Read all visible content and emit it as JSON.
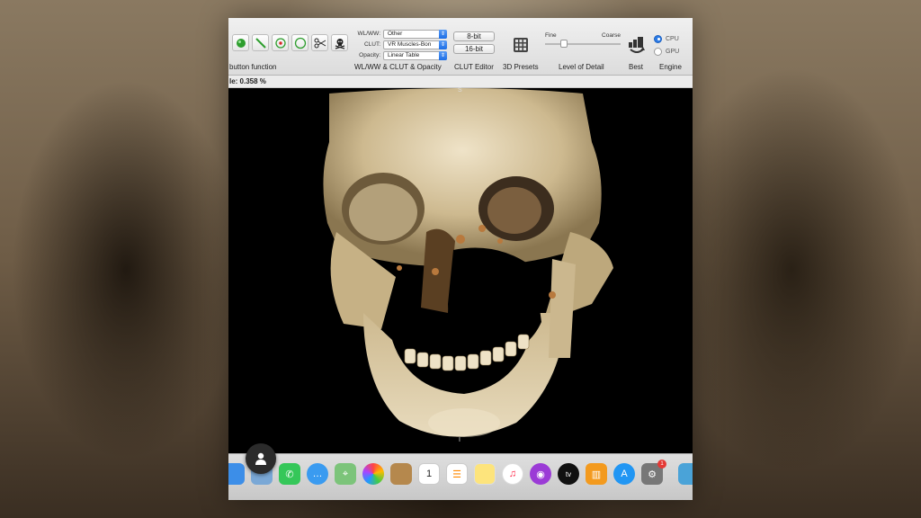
{
  "toolbar": {
    "left_caption": "button function",
    "wl": {
      "wlww_label": "WL/WW:",
      "wlww_value": "Other",
      "clut_label": "CLUT:",
      "clut_value": "VR Muscles-Bon",
      "opacity_label": "Opacity:",
      "opacity_value": "Linear Table",
      "caption": "WL/WW & CLUT & Opacity"
    },
    "bits": {
      "bit8": "8-bit",
      "bit16": "16-bit",
      "caption": "CLUT Editor"
    },
    "presets_caption": "3D Presets",
    "lod": {
      "fine": "Fine",
      "coarse": "Coarse",
      "caption": "Level of Detail",
      "level": 0.25
    },
    "best_caption": "Best",
    "engine": {
      "cpu": "CPU",
      "gpu": "GPU",
      "caption": "Engine",
      "selected": "CPU"
    }
  },
  "status": {
    "scale_text": "le: 0.358 %"
  },
  "viewer": {
    "top_marker": "S",
    "bottom_marker": "I"
  },
  "dock": {
    "calendar_day": "1",
    "settings_badge": "1",
    "tv_label": "tv",
    "icons": [
      "finder-icon",
      "preview-icon",
      "facetime-icon",
      "messages-icon",
      "maps-icon",
      "photos-icon",
      "contacts-icon",
      "calendar-icon",
      "reminders-icon",
      "notes-icon",
      "music-icon",
      "podcasts-icon",
      "tv-icon",
      "books-icon",
      "app-store-icon",
      "system-preferences-icon",
      "osirix-icon"
    ]
  },
  "colors": {
    "accent": "#2c7be5",
    "bone": "#d8c7a2",
    "background": "#000000"
  }
}
